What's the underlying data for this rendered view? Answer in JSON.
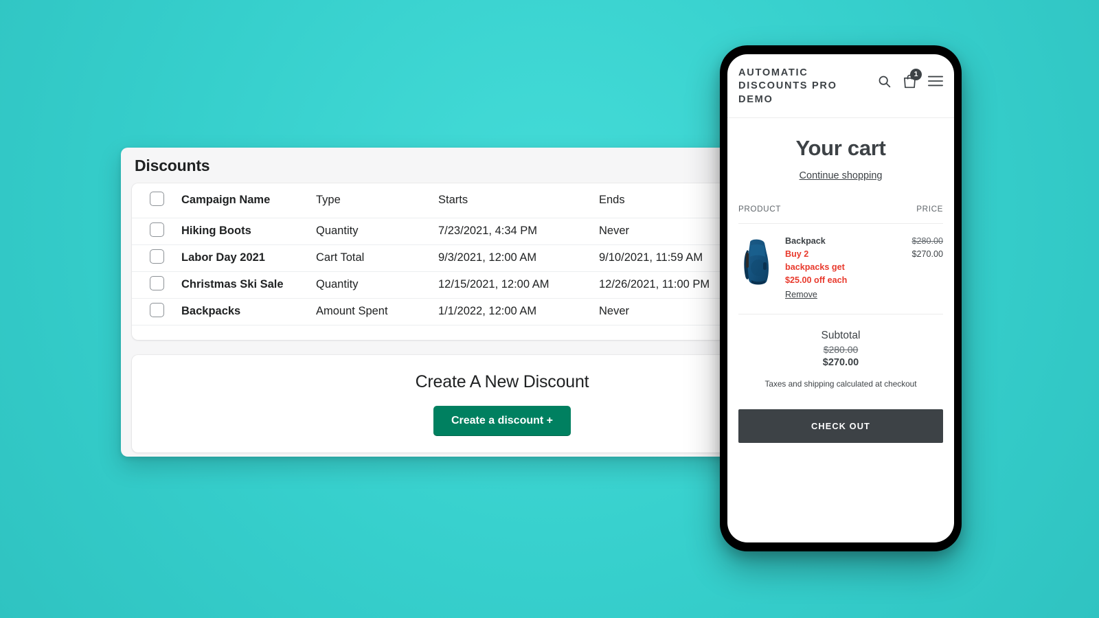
{
  "background_color": "#3ed5d2",
  "discounts_panel": {
    "title": "Discounts",
    "table": {
      "columns": [
        "Campaign Name",
        "Type",
        "Starts",
        "Ends"
      ],
      "rows": [
        {
          "name": "Hiking Boots",
          "type": "Quantity",
          "starts": "7/23/2021, 4:34 PM",
          "ends": "Never"
        },
        {
          "name": "Labor Day 2021",
          "type": "Cart Total",
          "starts": "9/3/2021, 12:00 AM",
          "ends": "9/10/2021, 11:59 AM"
        },
        {
          "name": "Christmas Ski Sale",
          "type": "Quantity",
          "starts": "12/15/2021, 12:00 AM",
          "ends": "12/26/2021, 11:00 PM"
        },
        {
          "name": "Backpacks",
          "type": "Amount Spent",
          "starts": "1/1/2022, 12:00 AM",
          "ends": "Never"
        }
      ]
    },
    "create": {
      "heading": "Create A New Discount",
      "button_label": "Create a discount +",
      "button_color": "#008060"
    }
  },
  "phone": {
    "header": {
      "shop_name": "AUTOMATIC DISCOUNTS PRO DEMO",
      "search_icon": "search-icon",
      "cart_icon": "shopping-bag-icon",
      "cart_count": "1",
      "menu_icon": "hamburger-menu-icon"
    },
    "cart": {
      "title": "Your cart",
      "continue_shopping": "Continue shopping",
      "col_product": "PRODUCT",
      "col_price": "PRICE",
      "item": {
        "name": "Backpack",
        "promo": "Buy 2 backpacks get $25.00 off each",
        "promo_color": "#e8392c",
        "remove_label": "Remove",
        "price_original": "$280.00",
        "price_discounted": "$270.00",
        "image": "blue-hiking-backpack"
      },
      "subtotal_label": "Subtotal",
      "subtotal_original": "$280.00",
      "subtotal_discounted": "$270.00",
      "taxes_note": "Taxes and shipping calculated at checkout",
      "checkout_label": "CHECK OUT"
    }
  }
}
